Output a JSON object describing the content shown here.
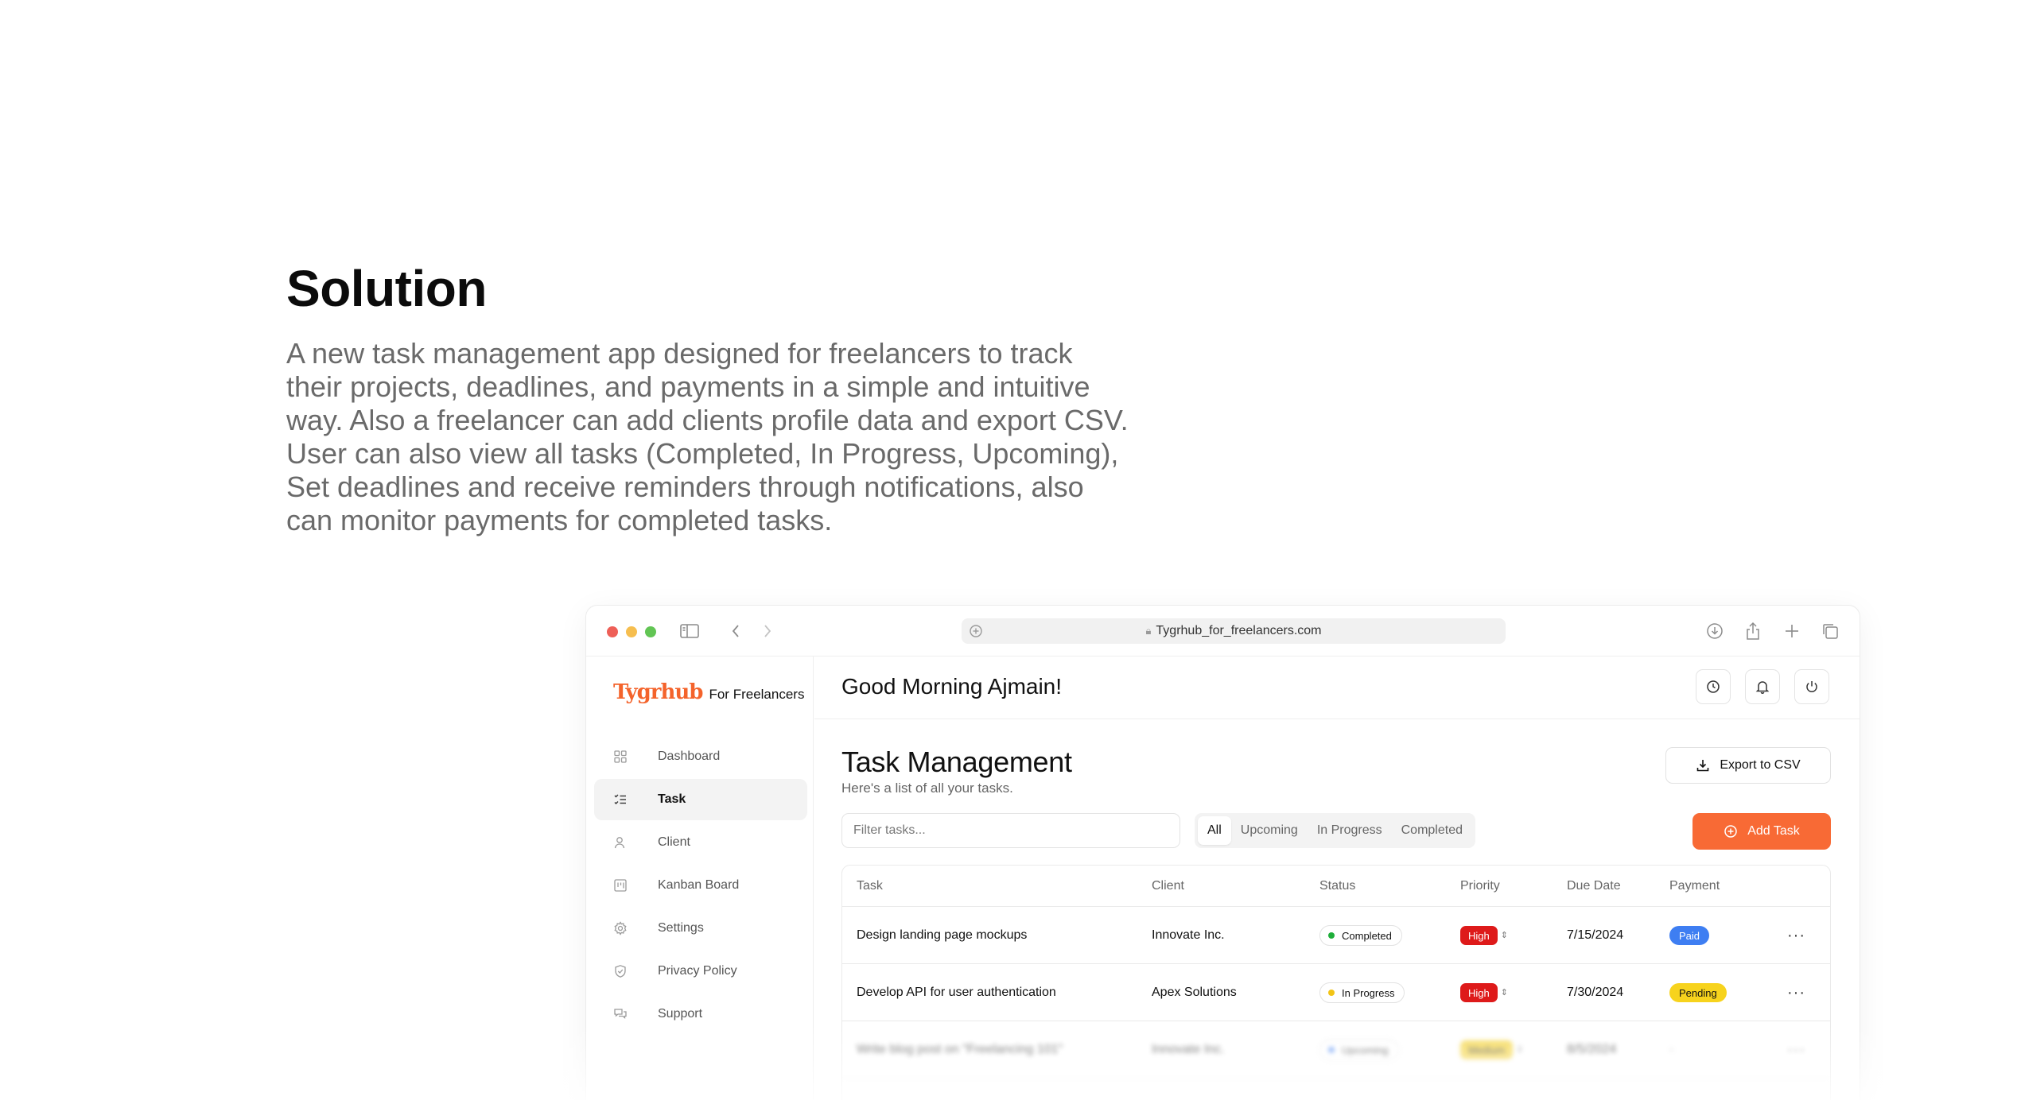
{
  "hero": {
    "title": "Solution",
    "description": "A new task management app designed for freelancers to track their projects, deadlines, and payments in a simple and intuitive way. Also a freelancer can add clients profile data and export CSV. User can also view all tasks (Completed, In Progress, Upcoming), Set deadlines and receive reminders through notifications, also can monitor payments for completed tasks."
  },
  "browser": {
    "url": "Tygrhub_for_freelancers.com"
  },
  "brand": {
    "logo": "Tygrhub",
    "tagline": "For Freelancers",
    "color": "#f4632b"
  },
  "sidebar": {
    "items": [
      {
        "label": "Dashboard",
        "icon": "grid-icon"
      },
      {
        "label": "Task",
        "icon": "task-list-icon",
        "active": true
      },
      {
        "label": "Client",
        "icon": "user-icon"
      },
      {
        "label": "Kanban Board",
        "icon": "kanban-icon"
      },
      {
        "label": "Settings",
        "icon": "gear-icon"
      },
      {
        "label": "Privacy Policy",
        "icon": "shield-icon"
      },
      {
        "label": "Support",
        "icon": "chat-icon"
      }
    ]
  },
  "header": {
    "greeting": "Good Morning Ajmain!"
  },
  "page": {
    "title": "Task Management",
    "subtitle": "Here's a list of all your tasks.",
    "export_label": "Export to CSV",
    "add_label": "Add Task",
    "filter_placeholder": "Filter tasks...",
    "accent": "#f86a35"
  },
  "tabs": [
    {
      "label": "All",
      "active": true
    },
    {
      "label": "Upcoming"
    },
    {
      "label": "In Progress"
    },
    {
      "label": "Completed"
    }
  ],
  "table": {
    "columns": [
      "Task",
      "Client",
      "Status",
      "Priority",
      "Due Date",
      "Payment"
    ],
    "rows": [
      {
        "task": "Design landing page mockups",
        "client": "Innovate Inc.",
        "status": "Completed",
        "status_color": "#1fae3a",
        "priority": "High",
        "due": "7/15/2024",
        "payment": "Paid",
        "more": "···"
      },
      {
        "task": "Develop API for user authentication",
        "client": "Apex Solutions",
        "status": "In Progress",
        "status_color": "#f2c416",
        "priority": "High",
        "due": "7/30/2024",
        "payment": "Pending",
        "more": "···"
      },
      {
        "task": "Write blog post on \"Freelancing 101\"",
        "client": "Innovate Inc.",
        "status": "Upcoming",
        "status_color": "#3e7ef2",
        "priority": "Medium",
        "due": "8/5/2024",
        "payment": "-",
        "more": "···"
      }
    ]
  }
}
